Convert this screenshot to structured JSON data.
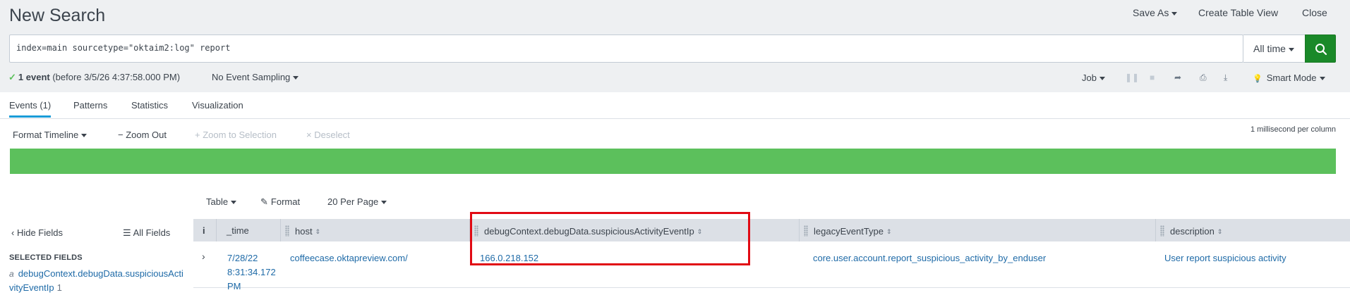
{
  "header": {
    "title": "New Search",
    "save_as": "Save As",
    "create_table_view": "Create Table View",
    "close": "Close"
  },
  "search": {
    "query": "index=main sourcetype=\"oktaim2:log\" report",
    "time_range": "All time"
  },
  "status": {
    "count": "1 event",
    "detail": "(before 3/5/26 4:37:58.000 PM)",
    "sampling": "No Event Sampling",
    "job": "Job",
    "mode": "Smart Mode"
  },
  "tabs": [
    "Events (1)",
    "Patterns",
    "Statistics",
    "Visualization"
  ],
  "timeline": {
    "format": "Format Timeline",
    "zoom_out": "Zoom Out",
    "zoom_selection": "Zoom to Selection",
    "deselect": "Deselect",
    "scale": "1 millisecond per column"
  },
  "results_toolbar": {
    "view": "Table",
    "format": "Format",
    "per_page": "20 Per Page"
  },
  "fields_panel": {
    "hide": "Hide Fields",
    "all": "All Fields",
    "selected_label": "SELECTED FIELDS",
    "selected": [
      {
        "type": "a",
        "name": "debugContext.debugData.suspiciousActivityEventIp",
        "count": "1"
      }
    ]
  },
  "table": {
    "columns": [
      "i",
      "_time",
      "host",
      "debugContext.debugData.suspiciousActivityEventIp",
      "legacyEventType",
      "description"
    ],
    "rows": [
      {
        "time_date": "7/28/22",
        "time_clock": "8:31:34.172",
        "time_ampm": "PM",
        "host": "coffeecase.oktapreview.com/",
        "ip": "166.0.218.152",
        "legacy": "core.user.account.report_suspicious_activity_by_enduser",
        "description": "User report suspicious activity"
      }
    ]
  },
  "colors": {
    "accent_green": "#5cc05c",
    "search_button": "#1a8929",
    "link": "#1e6aa7",
    "highlight": "#e10a14"
  }
}
